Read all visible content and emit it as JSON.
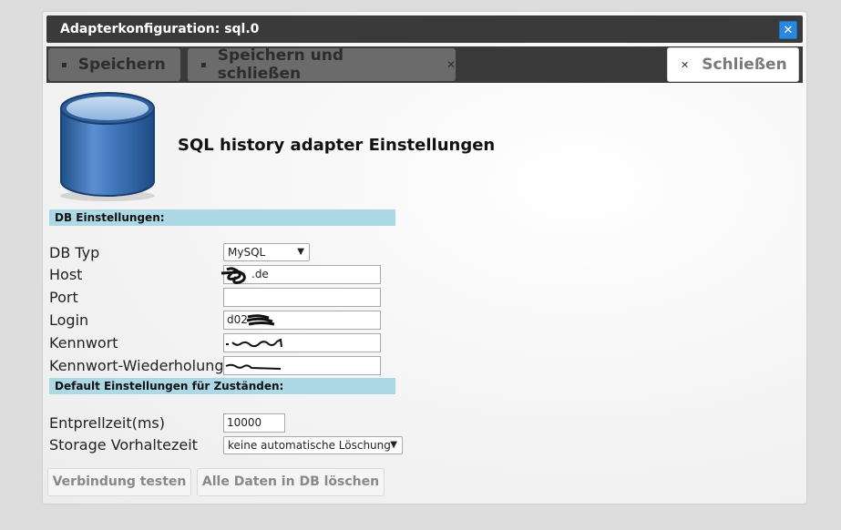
{
  "window": {
    "title": "Adapterkonfiguration: sql.0",
    "close_glyph": "✕"
  },
  "toolbar": {
    "save_label": "Speichern",
    "save_close_label": "Speichern und schließen",
    "close_label": "Schließen",
    "save_icon": "floppy-icon",
    "close_icon": "close-icon"
  },
  "header": {
    "title": "SQL history adapter Einstellungen",
    "icon": "database-icon"
  },
  "db_section": {
    "title": "DB Einstellungen:",
    "fields": {
      "db_type": {
        "label": "DB Typ",
        "value": "MySQL"
      },
      "host": {
        "label": "Host",
        "value": ".de"
      },
      "port": {
        "label": "Port",
        "value": ""
      },
      "login": {
        "label": "Login",
        "value": "d02"
      },
      "password": {
        "label": "Kennwort",
        "value": ""
      },
      "password_repeat": {
        "label": "Kennwort-Wiederholung",
        "value": ""
      }
    }
  },
  "default_section": {
    "title": "Default Einstellungen für Zuständen:",
    "fields": {
      "debounce": {
        "label": "Entprellzeit(ms)",
        "value": "10000"
      },
      "retention": {
        "label": "Storage Vorhaltezeit",
        "value": "keine automatische Löschung"
      }
    }
  },
  "actions": {
    "test_connection": "Verbindung testen",
    "delete_all": "Alle Daten in DB löschen"
  },
  "colors": {
    "titlebar": "#3a3a3a",
    "section_bg": "#add8e6",
    "close_x_bg": "#2a88de"
  }
}
